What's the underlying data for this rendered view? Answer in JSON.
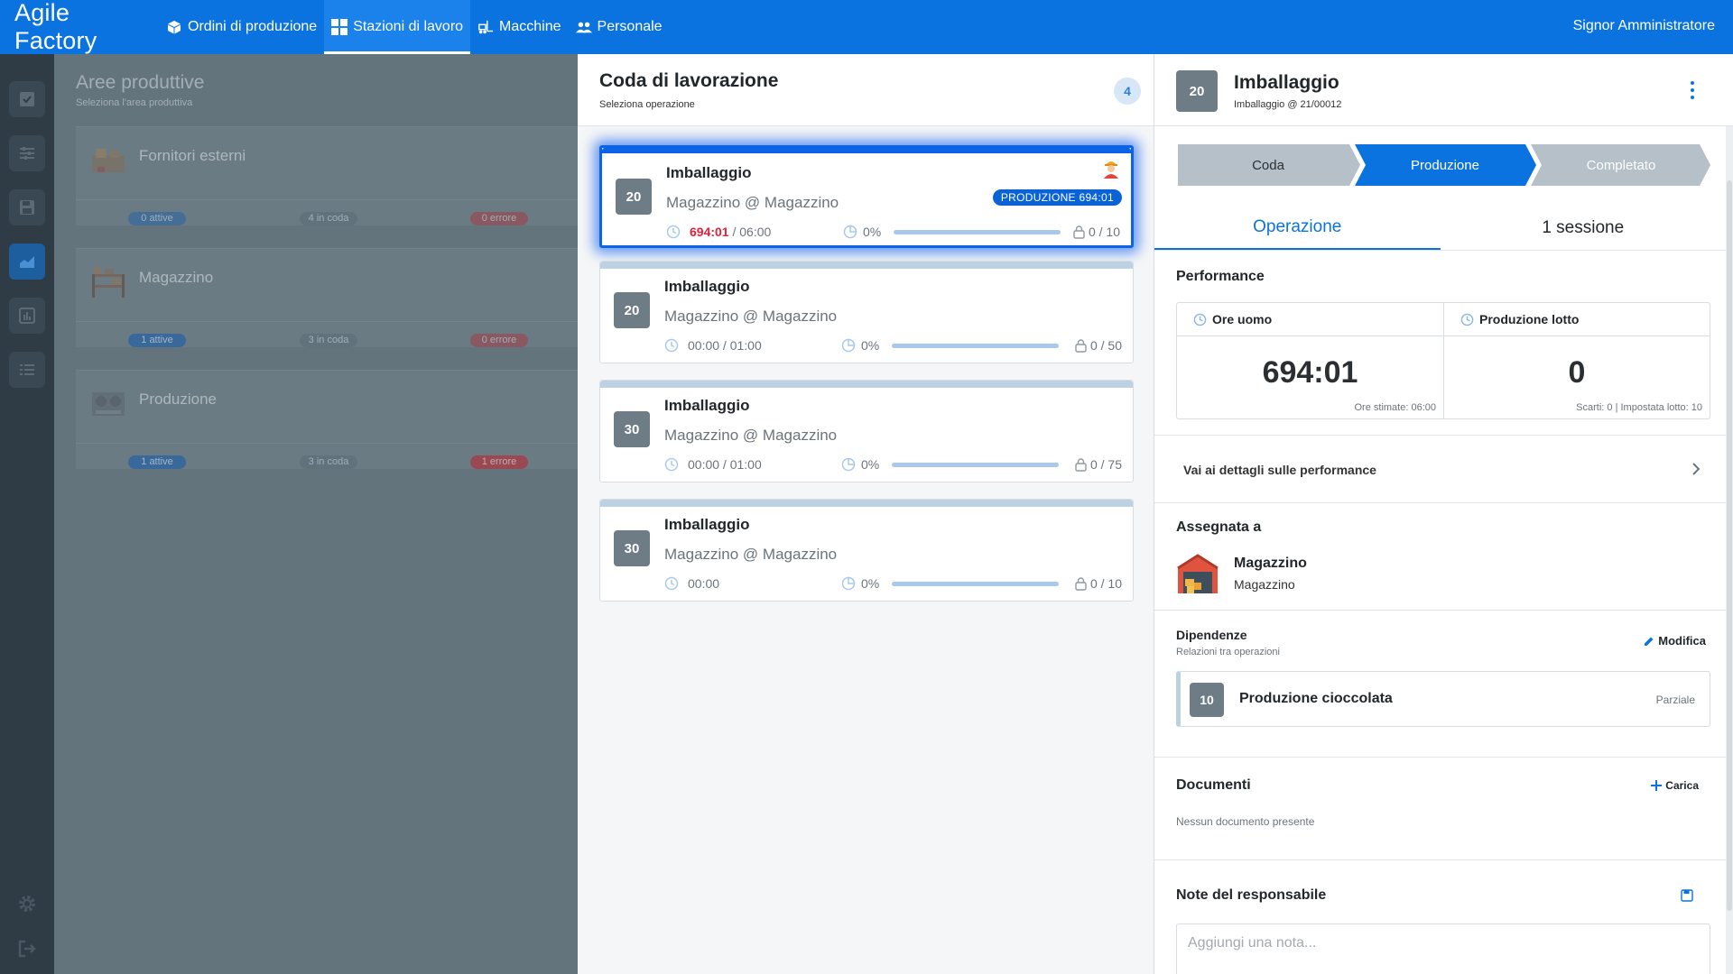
{
  "app": {
    "title": "Agile Factory",
    "user": "Signor Amministratore",
    "nav": [
      {
        "label": "Ordini di produzione",
        "icon": "cube-icon"
      },
      {
        "label": "Stazioni di lavoro",
        "icon": "grid-icon",
        "active": true
      },
      {
        "label": "Macchine",
        "icon": "forklift-icon"
      },
      {
        "label": "Personale",
        "icon": "people-icon"
      }
    ]
  },
  "rail": [
    "checklist-icon",
    "sliders-icon",
    "save-icon",
    "area-chart-icon",
    "bar-chart-icon",
    "list-icon",
    "gear-icon",
    "logout-icon"
  ],
  "areas": {
    "title": "Aree produttive",
    "subtitle": "Seleziona l'area produttiva",
    "items": [
      {
        "name": "Fornitori esterni",
        "active": "0 attive",
        "queue": "4 in coda",
        "errors": "0 errore"
      },
      {
        "name": "Magazzino",
        "active": "1 attive",
        "queue": "3 in coda",
        "errors": "0 errore"
      },
      {
        "name": "Produzione",
        "active": "1 attive",
        "queue": "3 in coda",
        "errors": "1 errore"
      }
    ]
  },
  "queue": {
    "title": "Coda di lavorazione",
    "subtitle": "Seleziona operazione",
    "count": "4",
    "cards": [
      {
        "num": "20",
        "title": "Imballaggio",
        "station": "Magazzino @ Magazzino",
        "time_actual": "694:01",
        "time_rest": " / 06:00",
        "pct": "0%",
        "progress": 0,
        "qty": "0 / 10",
        "tag": "PRODUZIONE  694:01",
        "selected": true
      },
      {
        "num": "20",
        "title": "Imballaggio",
        "station": "Magazzino @ Magazzino",
        "time_actual": "",
        "time_rest": "00:00 / 01:00",
        "pct": "0%",
        "progress": 0,
        "qty": "0 / 50"
      },
      {
        "num": "30",
        "title": "Imballaggio",
        "station": "Magazzino @ Magazzino",
        "time_actual": "",
        "time_rest": "00:00 / 01:00",
        "pct": "0%",
        "progress": 0,
        "qty": "0 / 75"
      },
      {
        "num": "30",
        "title": "Imballaggio",
        "station": "Magazzino @ Magazzino",
        "time_actual": "",
        "time_rest": "00:00",
        "pct": "0%",
        "progress": 0,
        "qty": "0 / 10"
      }
    ]
  },
  "detail": {
    "num": "20",
    "title": "Imballaggio",
    "subtitle": "Imballaggio @ 21/00012",
    "steps": [
      "Coda",
      "Produzione",
      "Completato"
    ],
    "active_step": 1,
    "tabs": [
      "Operazione",
      "1 sessione"
    ],
    "performance": {
      "label": "Performance",
      "hours_label": "Ore uomo",
      "hours_value": "694:01",
      "hours_note": "Ore stimate: 06:00",
      "lot_label": "Produzione lotto",
      "lot_value": "0",
      "lot_note": "Scarti: 0 | Impostata lotto: 10",
      "link": "Vai ai dettagli sulle performance"
    },
    "assigned": {
      "label": "Assegnata a",
      "name": "Magazzino",
      "sub": "Magazzino"
    },
    "dependencies": {
      "label": "Dipendenze",
      "sub": "Relazioni tra operazioni",
      "edit": "Modifica",
      "item": {
        "num": "10",
        "name": "Produzione cioccolata",
        "status": "Parziale"
      }
    },
    "documents": {
      "label": "Documenti",
      "upload": "Carica",
      "empty": "Nessun documento presente"
    },
    "notes": {
      "label": "Note del responsabile",
      "placeholder": "Aggiungi una nota..."
    }
  },
  "colors": {
    "primary": "#0a73e0",
    "danger": "#e0213c",
    "badge": "#6e7c86"
  }
}
